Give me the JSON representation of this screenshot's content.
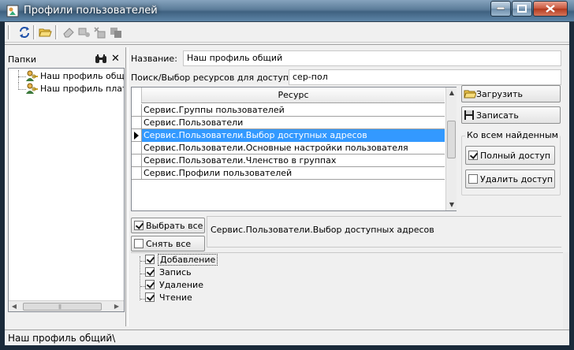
{
  "window": {
    "title": "Профили пользователей"
  },
  "left_panel": {
    "header_label": "Папки",
    "tree_items": [
      {
        "label": "Наш профиль общи"
      },
      {
        "label": "Наш профиль плате"
      }
    ]
  },
  "form": {
    "name_label": "Название:",
    "name_value": "Наш профиль общий",
    "search_label": "Поиск/Выбор ресурсов для доступа",
    "search_value": "сер-пол"
  },
  "grid": {
    "column_header": "Ресурс",
    "rows": [
      {
        "label": "Сервис.Группы пользователей"
      },
      {
        "label": "Сервис.Пользователи"
      },
      {
        "label": "Сервис.Пользователи.Выбор доступных адресов"
      },
      {
        "label": "Сервис.Пользователи.Основные настройки пользователя"
      },
      {
        "label": "Сервис.Пользователи.Членство в группах"
      },
      {
        "label": "Сервис.Профили пользователей"
      }
    ],
    "selected_index": 2
  },
  "side_buttons": {
    "load_label": "Загрузить",
    "save_label": "Записать"
  },
  "group": {
    "label": "Ко всем найденным",
    "full_access_label": "Полный доступ",
    "remove_access_label": "Удалить доступ"
  },
  "select_buttons": {
    "select_all_label": "Выбрать все",
    "deselect_all_label": "Снять все"
  },
  "selected_path": "Сервис.Пользователи.Выбор доступных адресов",
  "permissions": [
    {
      "label": "Добавление",
      "checked": true
    },
    {
      "label": "Запись",
      "checked": true
    },
    {
      "label": "Удаление",
      "checked": true
    },
    {
      "label": "Чтение",
      "checked": true
    }
  ],
  "status": {
    "text": "Наш профиль общий\\"
  },
  "colors": {
    "selection": "#3399ff",
    "titlebar": "#4f7294",
    "close_button": "#c8553b"
  }
}
